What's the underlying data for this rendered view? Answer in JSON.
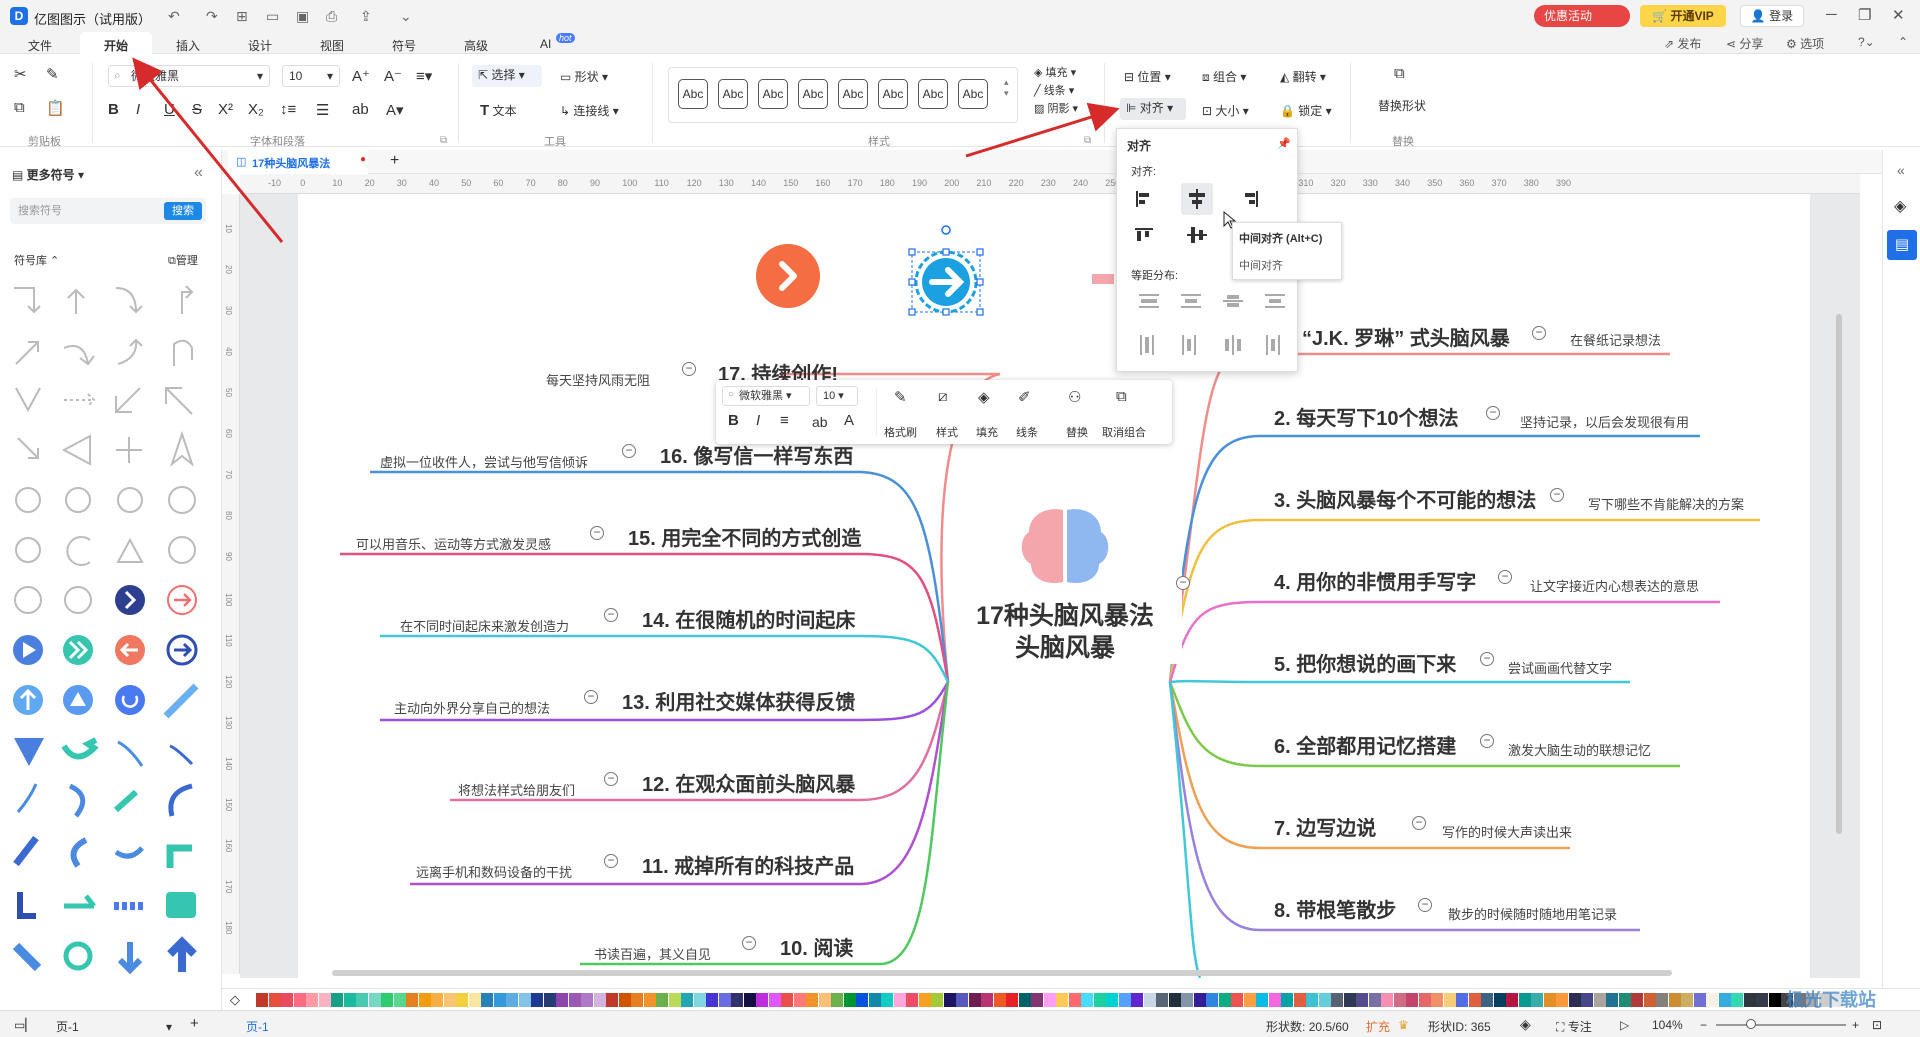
{
  "app": {
    "title": "亿图图示（试用版）",
    "promo_label": "优惠活动",
    "vip_label": "开通VIP",
    "login_label": "登录"
  },
  "menu": {
    "tabs": [
      "文件",
      "开始",
      "插入",
      "设计",
      "视图",
      "符号",
      "高级",
      "AI"
    ],
    "active_tab": "开始",
    "hot_badge": "hot",
    "right_actions": [
      "发布",
      "分享",
      "选项"
    ]
  },
  "ribbon": {
    "groups": [
      "剪贴板",
      "字体和段落",
      "工具",
      "样式",
      "替换"
    ],
    "font_name": "微软雅黑",
    "font_size": "10",
    "select_label": "选择",
    "shape_label": "形状",
    "text_label": "文本",
    "connector_label": "连接线",
    "style_preset": "Abc",
    "fill_label": "填充",
    "line_label": "线条",
    "shadow_label": "阴影",
    "position_label": "位置",
    "group_label": "组合",
    "flip_label": "翻转",
    "align_label": "对齐",
    "size_label": "大小",
    "lock_label": "锁定",
    "replace_shape_label": "替换形状"
  },
  "left_panel": {
    "title": "更多符号",
    "search_placeholder": "搜索符号",
    "search_button": "搜索",
    "library_label": "符号库",
    "manage_label": "管理"
  },
  "document": {
    "tab_name": "17种头脑风暴法"
  },
  "ruler": {
    "h_ticks": [
      "-10",
      "0",
      "10",
      "20",
      "30",
      "40",
      "50",
      "60",
      "70",
      "80",
      "90",
      "100",
      "110",
      "120",
      "130",
      "140",
      "150",
      "160",
      "170",
      "180",
      "190",
      "200",
      "210",
      "220",
      "230",
      "240",
      "250",
      "260",
      "270",
      "280",
      "290",
      "300",
      "310",
      "320",
      "330",
      "340",
      "350",
      "360",
      "370",
      "380",
      "390"
    ],
    "v_ticks": [
      "10",
      "20",
      "30",
      "40",
      "50",
      "60",
      "70",
      "80",
      "90",
      "100",
      "110",
      "120",
      "130",
      "140",
      "150",
      "160",
      "170",
      "180"
    ]
  },
  "mindmap": {
    "central_title_line1": "17种头脑风暴法",
    "central_title_line2": "头脑风暴",
    "right": [
      {
        "topic": "“J.K. 罗琳” 式头脑风暴",
        "note": "在餐纸记录想法",
        "color": "#f08c8c"
      },
      {
        "topic": "2. 每天写下10个想法",
        "note": "坚持记录，以后会发现很有用",
        "color": "#4a90d9"
      },
      {
        "topic": "3. 头脑风暴每个不可能的想法",
        "note": "写下哪些不肯能解决的方案",
        "color": "#f0c040"
      },
      {
        "topic": "4. 用你的非惯用手写字",
        "note": "让文字接近内心想表达的意思",
        "color": "#e870c8"
      },
      {
        "topic": "5. 把你想说的画下来",
        "note": "尝试画画代替文字",
        "color": "#40c8d8"
      },
      {
        "topic": "6. 全部都用记忆搭建",
        "note": "激发大脑生动的联想记忆",
        "color": "#7cc84a"
      },
      {
        "topic": "7. 边写边说",
        "note": "写作的时候大声读出来",
        "color": "#f0a050"
      },
      {
        "topic": "8. 带根笔散步",
        "note": "散步的时候随时随地用笔记录",
        "color": "#9a80e0"
      }
    ],
    "left": [
      {
        "topic": "17. 持续创作!",
        "note": "每天坚持风雨无阻",
        "color": "#f08c8c"
      },
      {
        "topic": "16. 像写信一样写东西",
        "note": "虚拟一位收件人，尝试与他写信倾诉",
        "color": "#4a90d9"
      },
      {
        "topic": "15. 用完全不同的方式创造",
        "note": "可以用音乐、运动等方式激发灵感",
        "color": "#e05080"
      },
      {
        "topic": "14. 在很随机的时间起床",
        "note": "在不同时间起床来激发创造力",
        "color": "#40c8d8"
      },
      {
        "topic": "13. 利用社交媒体获得反馈",
        "note": "主动向外界分享自己的想法",
        "color": "#9a50e0"
      },
      {
        "topic": "12. 在观众面前头脑风暴",
        "note": "将想法样式给朋友们",
        "color": "#e070a0"
      },
      {
        "topic": "11. 戒掉所有的科技产品",
        "note": "远离手机和数码设备的干扰",
        "color": "#b050d0"
      },
      {
        "topic": "10. 阅读",
        "note": "书读百遍，其义自见",
        "color": "#50c860"
      }
    ]
  },
  "mini_toolbar": {
    "font": "微软雅黑",
    "size": "10",
    "labels": [
      "格式刷",
      "样式",
      "填充",
      "线条",
      "替换",
      "取消组合"
    ]
  },
  "align_dropdown": {
    "title": "对齐",
    "align_section": "对齐:",
    "distribute_section": "等距分布:",
    "tooltip_title": "中间对齐 (Alt+C)",
    "tooltip_desc": "中间对齐"
  },
  "status": {
    "page_label": "页-1",
    "page_tab": "页-1",
    "shape_count_label": "形状数:",
    "shape_count": "20.5/60",
    "expand": "扩充",
    "shape_id_label": "形状ID:",
    "shape_id": "365",
    "focus_label": "专注",
    "zoom": "104%"
  },
  "watermark": "极光下载站",
  "colors": {
    "accent": "#1e6fe8",
    "arrow_red": "#d62b2b",
    "orange_circle": "#f46d43",
    "blue_arrow": "#1ba1e2"
  }
}
